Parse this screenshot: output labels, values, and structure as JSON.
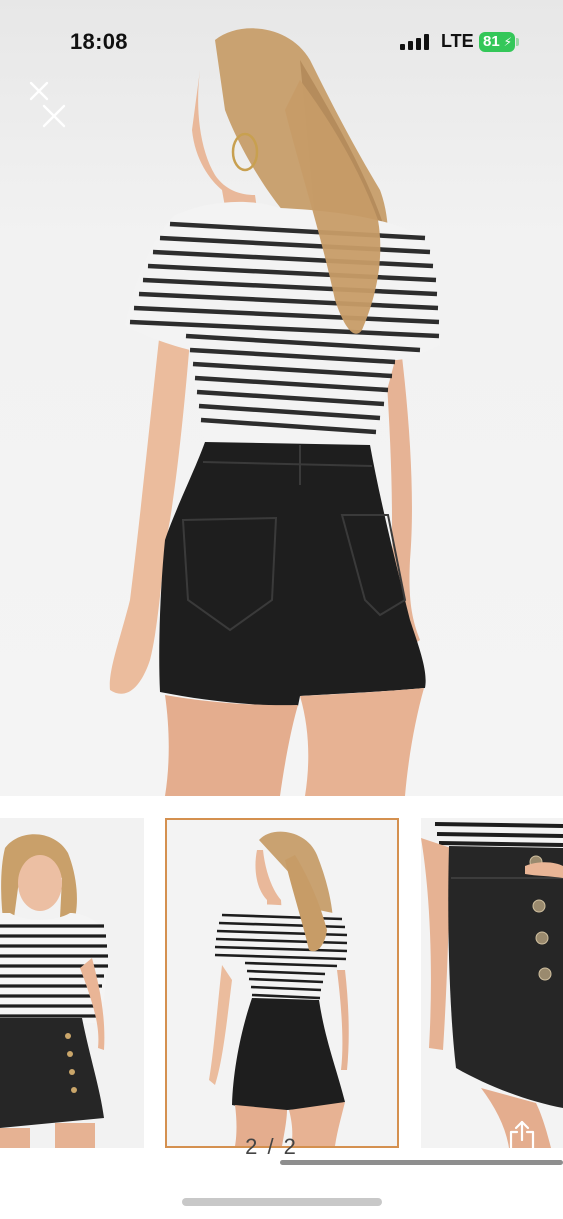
{
  "status_bar": {
    "time": "18:08",
    "network": "LTE",
    "battery_level": "81",
    "battery_color": "#34c759"
  },
  "viewer": {
    "close_icon": "close-icon",
    "share_icon": "share-icon",
    "page_indicator": "2 / 2",
    "selected_thumbnail": 2,
    "thumbnail_border_color": "#d4904f"
  },
  "thumbnails": [
    {
      "icon": "model-front-photo"
    },
    {
      "icon": "model-back-photo"
    },
    {
      "icon": "shorts-button-detail-photo"
    }
  ]
}
